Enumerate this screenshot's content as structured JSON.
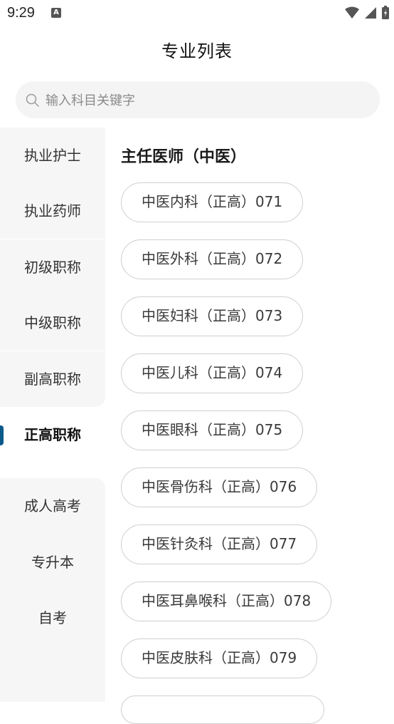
{
  "status_bar": {
    "time": "9:29",
    "notification_badge": "A"
  },
  "page_title": "专业列表",
  "search": {
    "placeholder": "输入科目关键字",
    "value": ""
  },
  "sidebar": {
    "active_index": 5,
    "items": [
      {
        "label": "执业护士"
      },
      {
        "label": "执业药师"
      },
      {
        "label": "初级职称"
      },
      {
        "label": "中级职称"
      },
      {
        "label": "副高职称"
      },
      {
        "label": "正高职称"
      },
      {
        "label": "成人高考"
      },
      {
        "label": "专升本"
      },
      {
        "label": "自考"
      }
    ]
  },
  "content": {
    "section_title": "主任医师（中医）",
    "subjects": [
      {
        "label": "中医内科（正高）071"
      },
      {
        "label": "中医外科（正高）072"
      },
      {
        "label": "中医妇科（正高）073"
      },
      {
        "label": "中医儿科（正高）074"
      },
      {
        "label": "中医眼科（正高）075"
      },
      {
        "label": "中医骨伤科（正高）076"
      },
      {
        "label": "中医针灸科（正高）077"
      },
      {
        "label": "中医耳鼻喉科（正高）078"
      },
      {
        "label": "中医皮肤科（正高）079"
      }
    ]
  },
  "colors": {
    "accent": "#0b5a8a",
    "sidebar_bg": "#f6f6f6",
    "pill_border": "#cfcfcf"
  }
}
